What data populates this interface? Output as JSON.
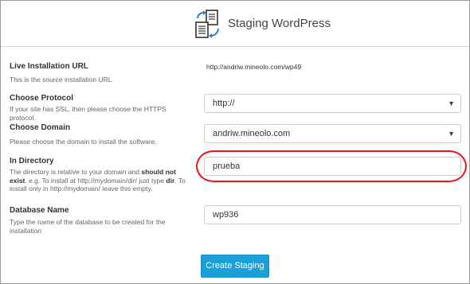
{
  "header": {
    "title": "Staging WordPress",
    "icon": "staging-documents-icon"
  },
  "fields": {
    "live_url": {
      "label": "Live Installation URL",
      "help": "This is the source installation URL",
      "value": "http://andriw.mineolo.com/wp49"
    },
    "protocol": {
      "label": "Choose Protocol",
      "help": "If your site has SSL, then please choose the HTTPS protocol.",
      "value": "http://"
    },
    "domain": {
      "label": "Choose Domain",
      "help": "Please choose the domain to install the software.",
      "value": "andriw.mineolo.com"
    },
    "directory": {
      "label": "In Directory",
      "help_part1": "The directory is relative to your domain and ",
      "help_bold1": "should not exist",
      "help_part2": ". e.g. To install at http://mydomain/dir/ just type ",
      "help_bold2": "dir",
      "help_part3": ". To install only in http://mydomain/ leave this empty.",
      "value": "prueba"
    },
    "database": {
      "label": "Database Name",
      "help": "Type the name of the database to be created for the installation",
      "value": "wp936"
    }
  },
  "actions": {
    "create_label": "Create Staging"
  },
  "colors": {
    "button": "#1aa0d8",
    "highlight": "#e8141c",
    "icon_blue": "#2a7fd4",
    "icon_dark": "#333333"
  }
}
